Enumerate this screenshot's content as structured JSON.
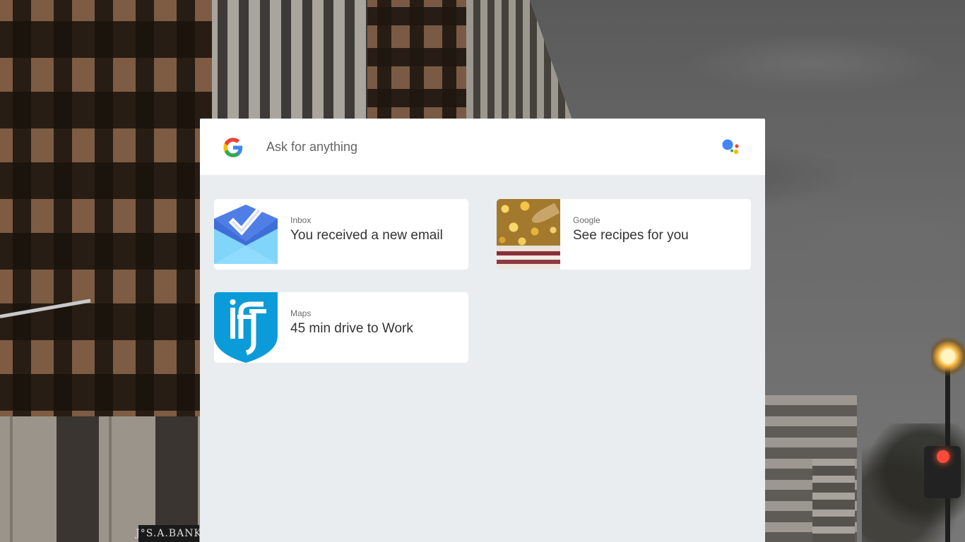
{
  "search": {
    "placeholder": "Ask for anything"
  },
  "cards": [
    {
      "source": "Inbox",
      "title": "You received a new email",
      "thumb": "inbox-envelope-icon"
    },
    {
      "source": "Google",
      "title": "See recipes for you",
      "thumb": "food-photo"
    },
    {
      "source": "Maps",
      "title": "45 min drive to Work",
      "thumb": "ist-shield-logo"
    }
  ],
  "background": {
    "sign_text": "J°S.A.BANK"
  },
  "colors": {
    "panel_bg": "#eaedf0",
    "card_bg": "#ffffff",
    "google_blue": "#4285f4",
    "google_red": "#ea4335",
    "google_yellow": "#fbbc05",
    "google_green": "#34a853",
    "inbox_blue": "#3f6ed8",
    "ist_blue": "#0b9bd9"
  }
}
